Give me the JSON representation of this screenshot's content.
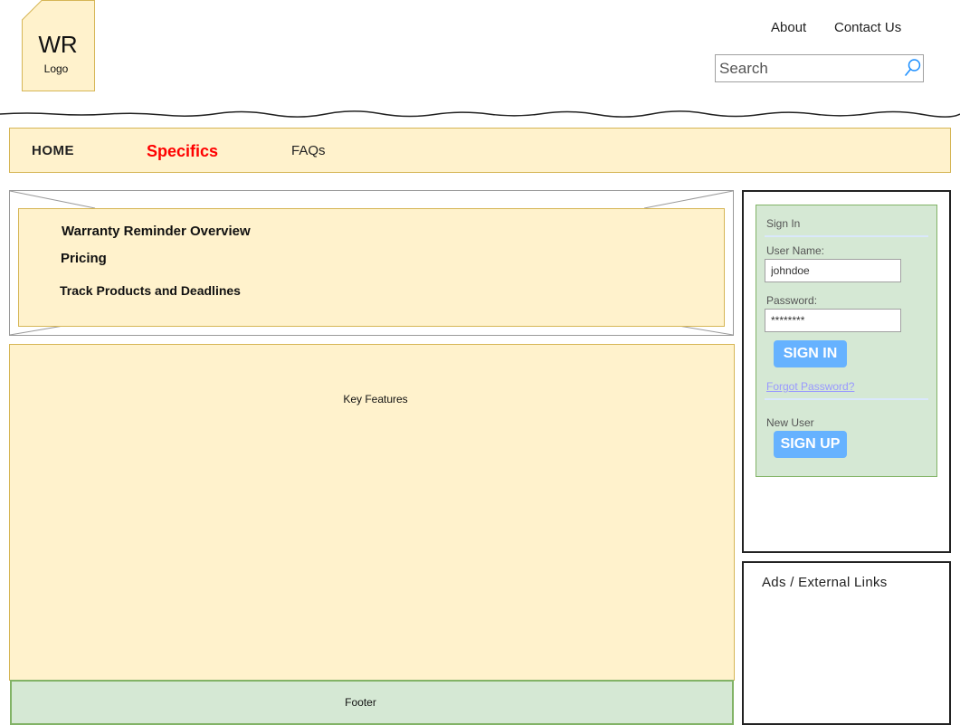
{
  "header": {
    "logo": {
      "title": "WR",
      "subtitle": "Logo"
    },
    "links": [
      {
        "label": "About"
      },
      {
        "label": "Contact Us"
      }
    ],
    "search": {
      "placeholder": "Search",
      "value": ""
    }
  },
  "nav": {
    "items": [
      {
        "label": "HOME"
      },
      {
        "label": "Specifics",
        "active": true
      },
      {
        "label": "FAQs"
      }
    ],
    "active_color": "#ff0000"
  },
  "submenu": {
    "items": [
      {
        "label": "Warranty Reminder Overview"
      },
      {
        "label": "Pricing"
      },
      {
        "label": "Track Products and Deadlines"
      }
    ]
  },
  "content": {
    "label": "Key Features"
  },
  "footer": {
    "label": "Footer"
  },
  "sidebar": {
    "signin": {
      "heading": "Sign In",
      "username_label": "User Name:",
      "username_value": "johndoe",
      "password_label": "Password:",
      "password_value": "********",
      "signin_button": "SIGN IN",
      "forgot_link": "Forgot Password?",
      "new_user_label": "New User",
      "signup_button": "SIGN UP"
    },
    "ads": {
      "label": "Ads / External Links"
    }
  },
  "colors": {
    "yellow_fill": "#fff2cc",
    "yellow_border": "#d6b656",
    "green_fill": "#d5e8d4",
    "green_border": "#82b366",
    "button_blue": "#66b2ff",
    "link_color": "#9999ff"
  }
}
